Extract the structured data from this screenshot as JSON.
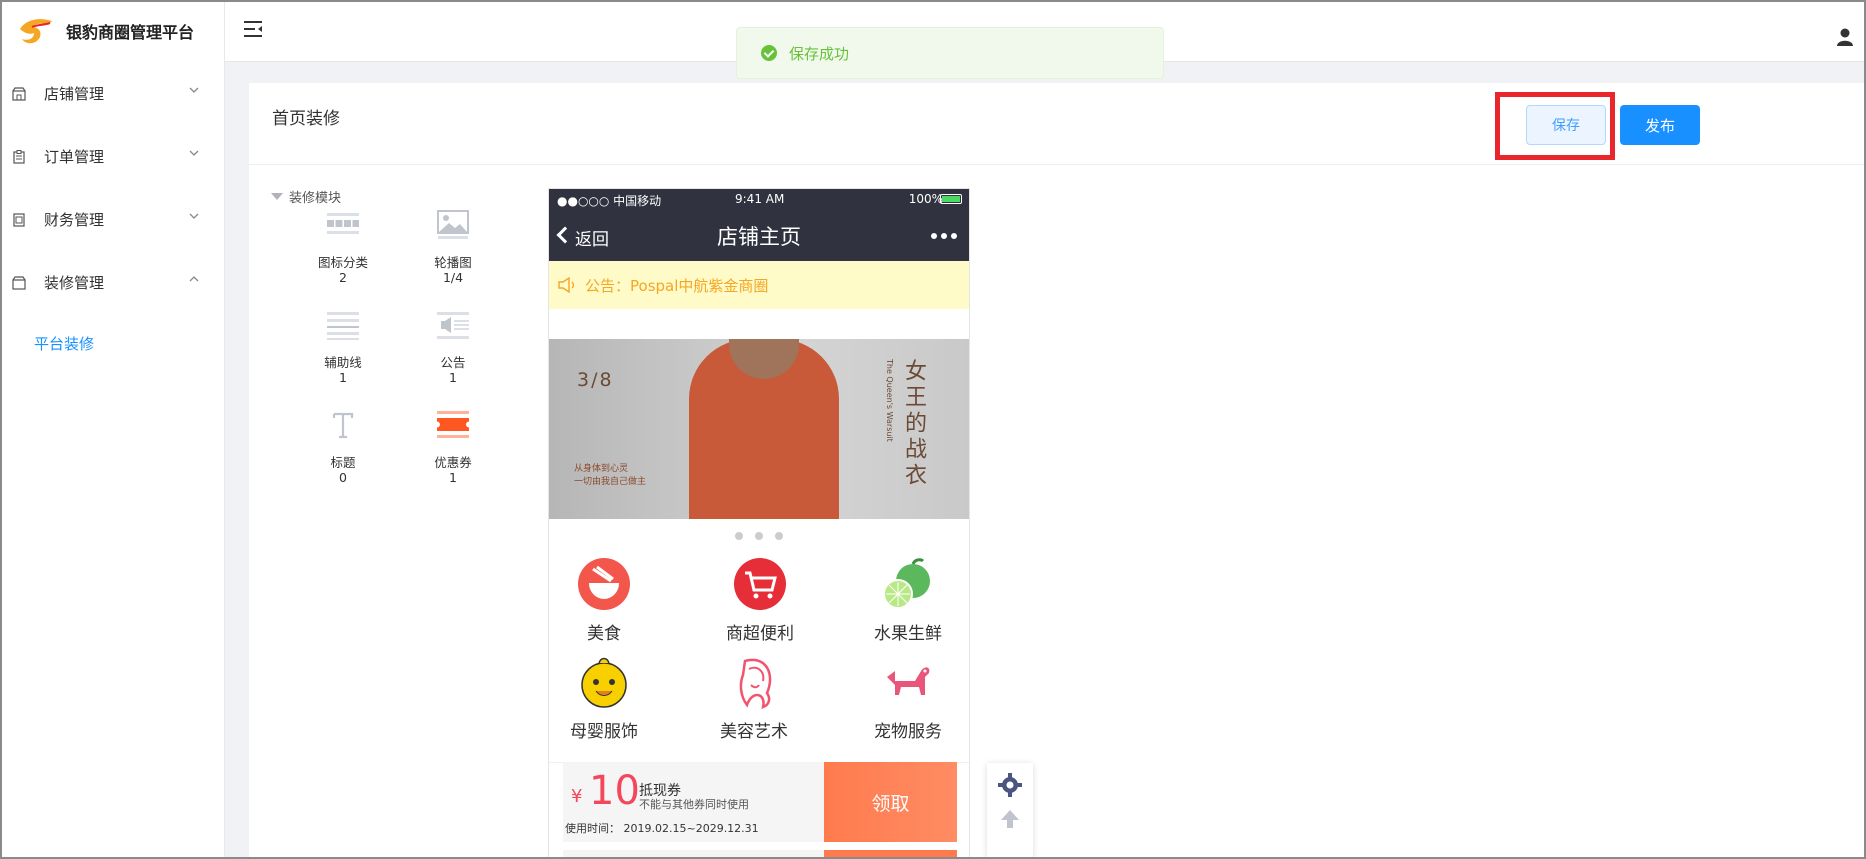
{
  "app": {
    "title": "银豹商圈管理平台"
  },
  "sidebar": {
    "items": [
      {
        "label": "店铺管理",
        "icon": "store-icon"
      },
      {
        "label": "订单管理",
        "icon": "clipboard-icon"
      },
      {
        "label": "财务管理",
        "icon": "finance-icon"
      },
      {
        "label": "装修管理",
        "icon": "decoration-icon"
      }
    ],
    "submenu": [
      {
        "label": "平台装修"
      }
    ]
  },
  "toast": {
    "message": "保存成功"
  },
  "page": {
    "title": "首页装修",
    "save_label": "保存",
    "publish_label": "发布"
  },
  "modules": {
    "title": "装修模块",
    "items": [
      {
        "label": "图标分类",
        "count": "2"
      },
      {
        "label": "轮播图",
        "count": "1/4"
      },
      {
        "label": "辅助线",
        "count": "1"
      },
      {
        "label": "公告",
        "count": "1"
      },
      {
        "label": "标题",
        "count": "0"
      },
      {
        "label": "优惠券",
        "count": "1"
      }
    ]
  },
  "phone": {
    "carrier": "●●○○○ 中国移动",
    "time": "9:41 AM",
    "battery": "100%",
    "back_label": "返回",
    "nav_title": "店铺主页",
    "notice": "公告：Pospal中航紫金商圈",
    "banner": {
      "page_indicator": "3/8",
      "slogan_line1": "从身体到心灵",
      "slogan_line2": "一切由我自己做主",
      "title": "女王的战衣",
      "subtitle": "The Queen's Warsuit"
    },
    "categories": [
      {
        "label": "美食"
      },
      {
        "label": "商超便利"
      },
      {
        "label": "水果生鲜"
      },
      {
        "label": "母婴服饰"
      },
      {
        "label": "美容艺术"
      },
      {
        "label": "宠物服务"
      }
    ],
    "coupon": {
      "currency": "¥",
      "amount": "10",
      "type": "抵现券",
      "desc": "不能与其他券同时使用",
      "validity": "使用时间：  2019.02.15~2029.12.31",
      "action": "领取"
    }
  },
  "colors": {
    "primary": "#1890ff",
    "success": "#67c23a",
    "highlight": "#e8262c",
    "phone_header": "#31323f",
    "coupon": "#f5475b"
  }
}
